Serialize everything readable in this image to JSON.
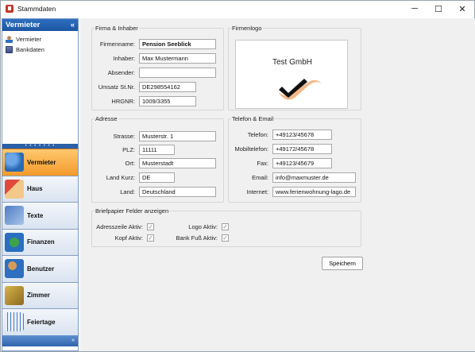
{
  "window": {
    "title": "Stammdaten",
    "minimize": "─",
    "maximize": "☐",
    "close": "✕"
  },
  "sidebar": {
    "header": "Vermieter",
    "collapse": "«",
    "items": [
      {
        "label": "Vermieter"
      },
      {
        "label": "Bankdaten"
      }
    ],
    "nav": [
      {
        "label": "Vermieter",
        "active": true
      },
      {
        "label": "Haus"
      },
      {
        "label": "Texte"
      },
      {
        "label": "Finanzen"
      },
      {
        "label": "Benutzer"
      },
      {
        "label": "Zimmer"
      },
      {
        "label": "Feiertage"
      }
    ],
    "footer_arrow": "»"
  },
  "firma": {
    "legend": "Firma & Inhaber",
    "firmenname_label": "Firmenname:",
    "firmenname": "Pension Seeblick",
    "inhaber_label": "Inhaber:",
    "inhaber": "Max Mustermann",
    "absender_label": "Absender:",
    "absender": "",
    "ust_label": "Umsatz St.Nr.",
    "ust": "DE298554162",
    "hrgnr_label": "HRGNR:",
    "hrgnr": "1009/3355"
  },
  "logo": {
    "legend": "Firmenlogo",
    "text": "Test GmbH"
  },
  "adresse": {
    "legend": "Adresse",
    "strasse_label": "Strasse:",
    "strasse": "Musterstr. 1",
    "plz_label": "PLZ:",
    "plz": "11111",
    "ort_label": "Ort:",
    "ort": "Musterstadt",
    "landkurz_label": "Land Kurz:",
    "landkurz": "DE",
    "land_label": "Land:",
    "land": "Deutschland"
  },
  "kontakt": {
    "legend": "Telefon & Email",
    "telefon_label": "Telefon:",
    "telefon": "+49123/45678",
    "mobil_label": "Mobiltelefon:",
    "mobil": "+49172/45678",
    "fax_label": "Fax:",
    "fax": "+49123/45679",
    "email_label": "Email:",
    "email": "info@maxmuster.de",
    "internet_label": "Internet:",
    "internet": "www.ferienwohnung-lago.de"
  },
  "briefpapier": {
    "legend": "Briefpapier Felder anzeigen",
    "adresszeile_label": "Adresszeile Aktiv:",
    "adresszeile": true,
    "kopf_label": "Kopf Aktiv:",
    "kopf": true,
    "logo_label": "Logo Aktiv:",
    "logo": true,
    "bankfuss_label": "Bank Fuß Aktiv:",
    "bankfuss": true,
    "check_glyph": "✓"
  },
  "actions": {
    "save_label": "Speichern"
  },
  "colors": {
    "accent": "#2e6fbf",
    "active_nav": "#f39a2a"
  }
}
